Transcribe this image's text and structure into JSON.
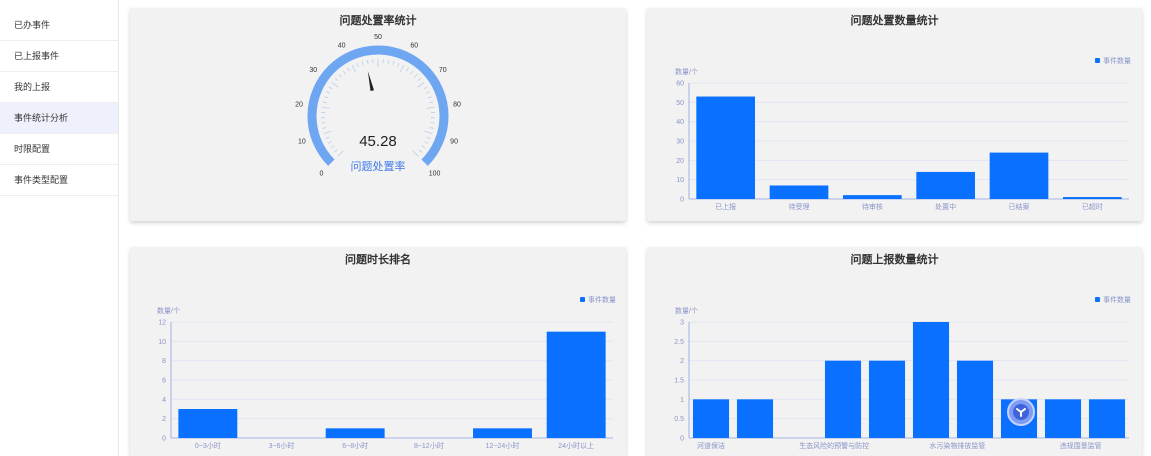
{
  "sidebar": {
    "items": [
      {
        "label": "已办事件",
        "active": false
      },
      {
        "label": "已上报事件",
        "active": false
      },
      {
        "label": "我的上报",
        "active": false
      },
      {
        "label": "事件统计分析",
        "active": true
      },
      {
        "label": "时限配置",
        "active": false
      },
      {
        "label": "事件类型配置",
        "active": false
      }
    ]
  },
  "colors": {
    "bar": "#0a70ff",
    "gauge": "#6ea6f2",
    "axis_text": "#8a94c9"
  },
  "panels": {
    "gauge_title": "问题处置率统计",
    "count_title": "问题处置数量统计",
    "duration_title": "问题时长排名",
    "report_title": "问题上报数量统计"
  },
  "chart_data": [
    {
      "type": "gauge",
      "title": "问题处置率统计",
      "value": 45.28,
      "value_label": "45.28",
      "name": "问题处置率",
      "min": 0,
      "max": 100,
      "ticks": [
        "0",
        "10",
        "20",
        "30",
        "40",
        "50",
        "60",
        "70",
        "80",
        "90",
        "100"
      ]
    },
    {
      "type": "bar",
      "title": "问题处置数量统计",
      "ylabel": "数量/个",
      "legend": "事件数量",
      "legend_position": "top-right",
      "categories": [
        "已上报",
        "待受理",
        "待审核",
        "处置中",
        "已结案",
        "已超时"
      ],
      "values": [
        53,
        7,
        2,
        14,
        24,
        1
      ],
      "ylim": [
        0,
        60
      ],
      "yticks": [
        "0",
        "10",
        "20",
        "30",
        "40",
        "50",
        "60"
      ]
    },
    {
      "type": "bar",
      "title": "问题时长排名",
      "ylabel": "数量/个",
      "legend": "事件数量",
      "legend_position": "top-right",
      "categories": [
        "0~3小时",
        "3~6小时",
        "6~8小时",
        "8~12小时",
        "12~24小时",
        "24小时以上"
      ],
      "values": [
        3,
        0,
        1,
        0,
        1,
        11
      ],
      "ylim": [
        0,
        12
      ],
      "yticks": [
        "0",
        "2",
        "4",
        "6",
        "8",
        "10",
        "12"
      ]
    },
    {
      "type": "bar",
      "title": "问题上报数量统计",
      "ylabel": "数量/个",
      "legend": "事件数量",
      "legend_position": "top-right",
      "categories": [
        "河道保洁",
        "",
        "生态风险的预警与防控",
        "",
        "水污染物排放监管",
        "",
        "违规围垦监管"
      ],
      "bar_values": [
        1,
        1,
        0,
        2,
        2,
        3,
        2,
        1,
        1,
        1
      ],
      "ylim": [
        0,
        3
      ],
      "yticks": [
        "0",
        "0.5",
        "1",
        "1.5",
        "2",
        "2.5",
        "3"
      ]
    }
  ]
}
